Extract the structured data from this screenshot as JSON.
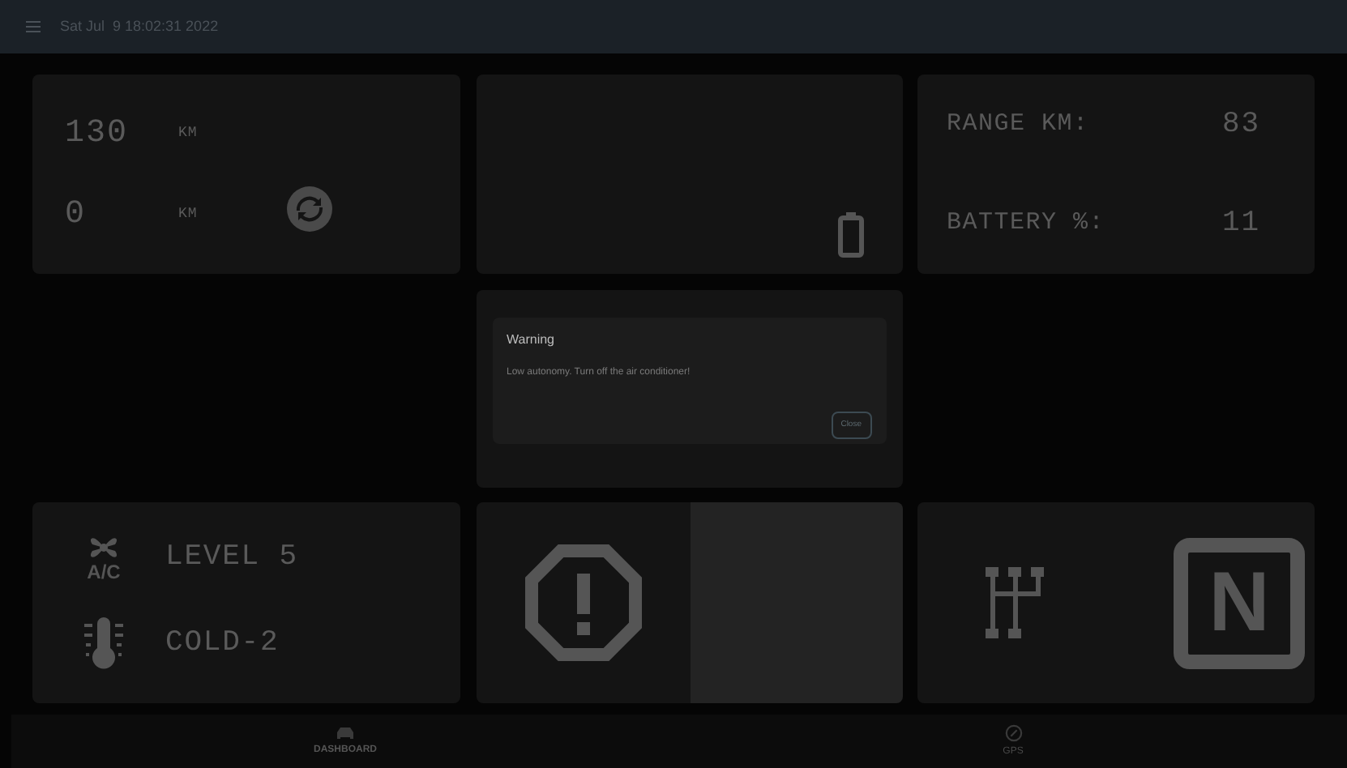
{
  "header": {
    "datetime": "Sat Jul  9 18:02:31 2022"
  },
  "trip": [
    {
      "value": "130",
      "unit": "KM"
    },
    {
      "value": "0",
      "unit": "KM"
    }
  ],
  "stats": [
    {
      "label": "RANGE KM:",
      "value": "83"
    },
    {
      "label": "BATTERY %:",
      "value": "11"
    }
  ],
  "dialog": {
    "title": "Warning",
    "message": "Low autonomy. Turn off the air conditioner!",
    "button": "Close"
  },
  "climate": {
    "ac_label": "A/C",
    "fan": "LEVEL 5",
    "temperature": "COLD-2"
  },
  "gear": {
    "position": "N"
  },
  "nav": [
    {
      "label": "DASHBOARD",
      "kind": "car",
      "selected": true
    },
    {
      "label": "GPS",
      "kind": "compass",
      "selected": false
    }
  ]
}
